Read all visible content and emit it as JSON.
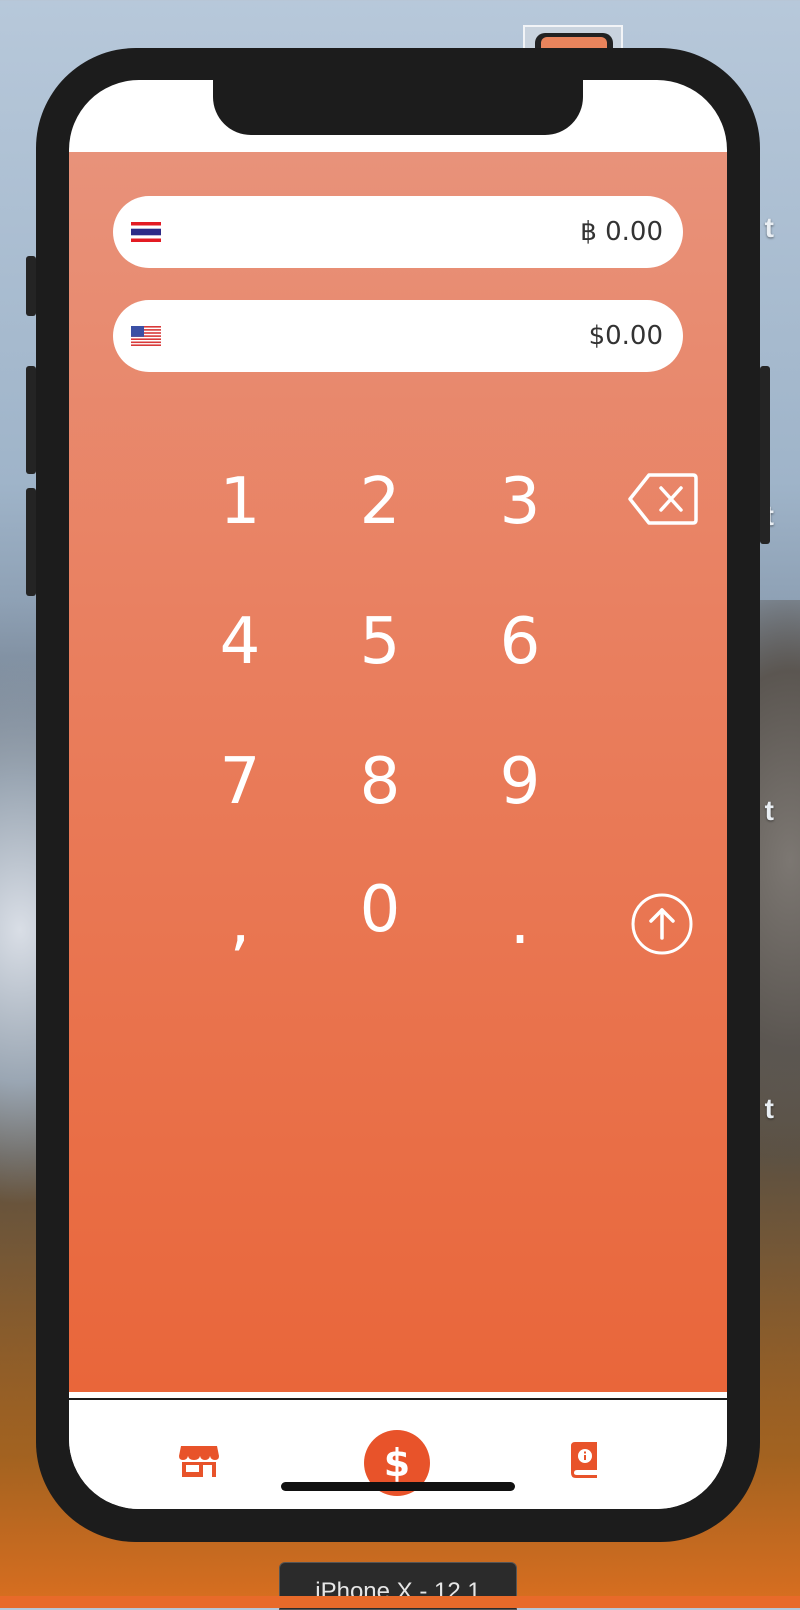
{
  "simulator": {
    "device_label": "iPhone X - 12.1"
  },
  "converter": {
    "from": {
      "flag": "thailand-flag-icon",
      "value": "฿ 0.00"
    },
    "to": {
      "flag": "us-flag-icon",
      "value": "$0.00"
    }
  },
  "keypad": {
    "keys": [
      "1",
      "2",
      "3",
      "4",
      "5",
      "6",
      "7",
      "8",
      "9",
      ",",
      "0",
      "."
    ],
    "backspace_icon": "backspace-icon",
    "swap_icon": "arrow-up-circle-icon"
  },
  "tabbar": {
    "items": [
      {
        "name": "store-icon",
        "active": false
      },
      {
        "name": "dollar-icon",
        "label": "$",
        "active": true
      },
      {
        "name": "book-info-icon",
        "active": false
      }
    ]
  },
  "colors": {
    "accent": "#e8532a",
    "gradient_top": "#e8927a",
    "gradient_bottom": "#e9663a"
  }
}
